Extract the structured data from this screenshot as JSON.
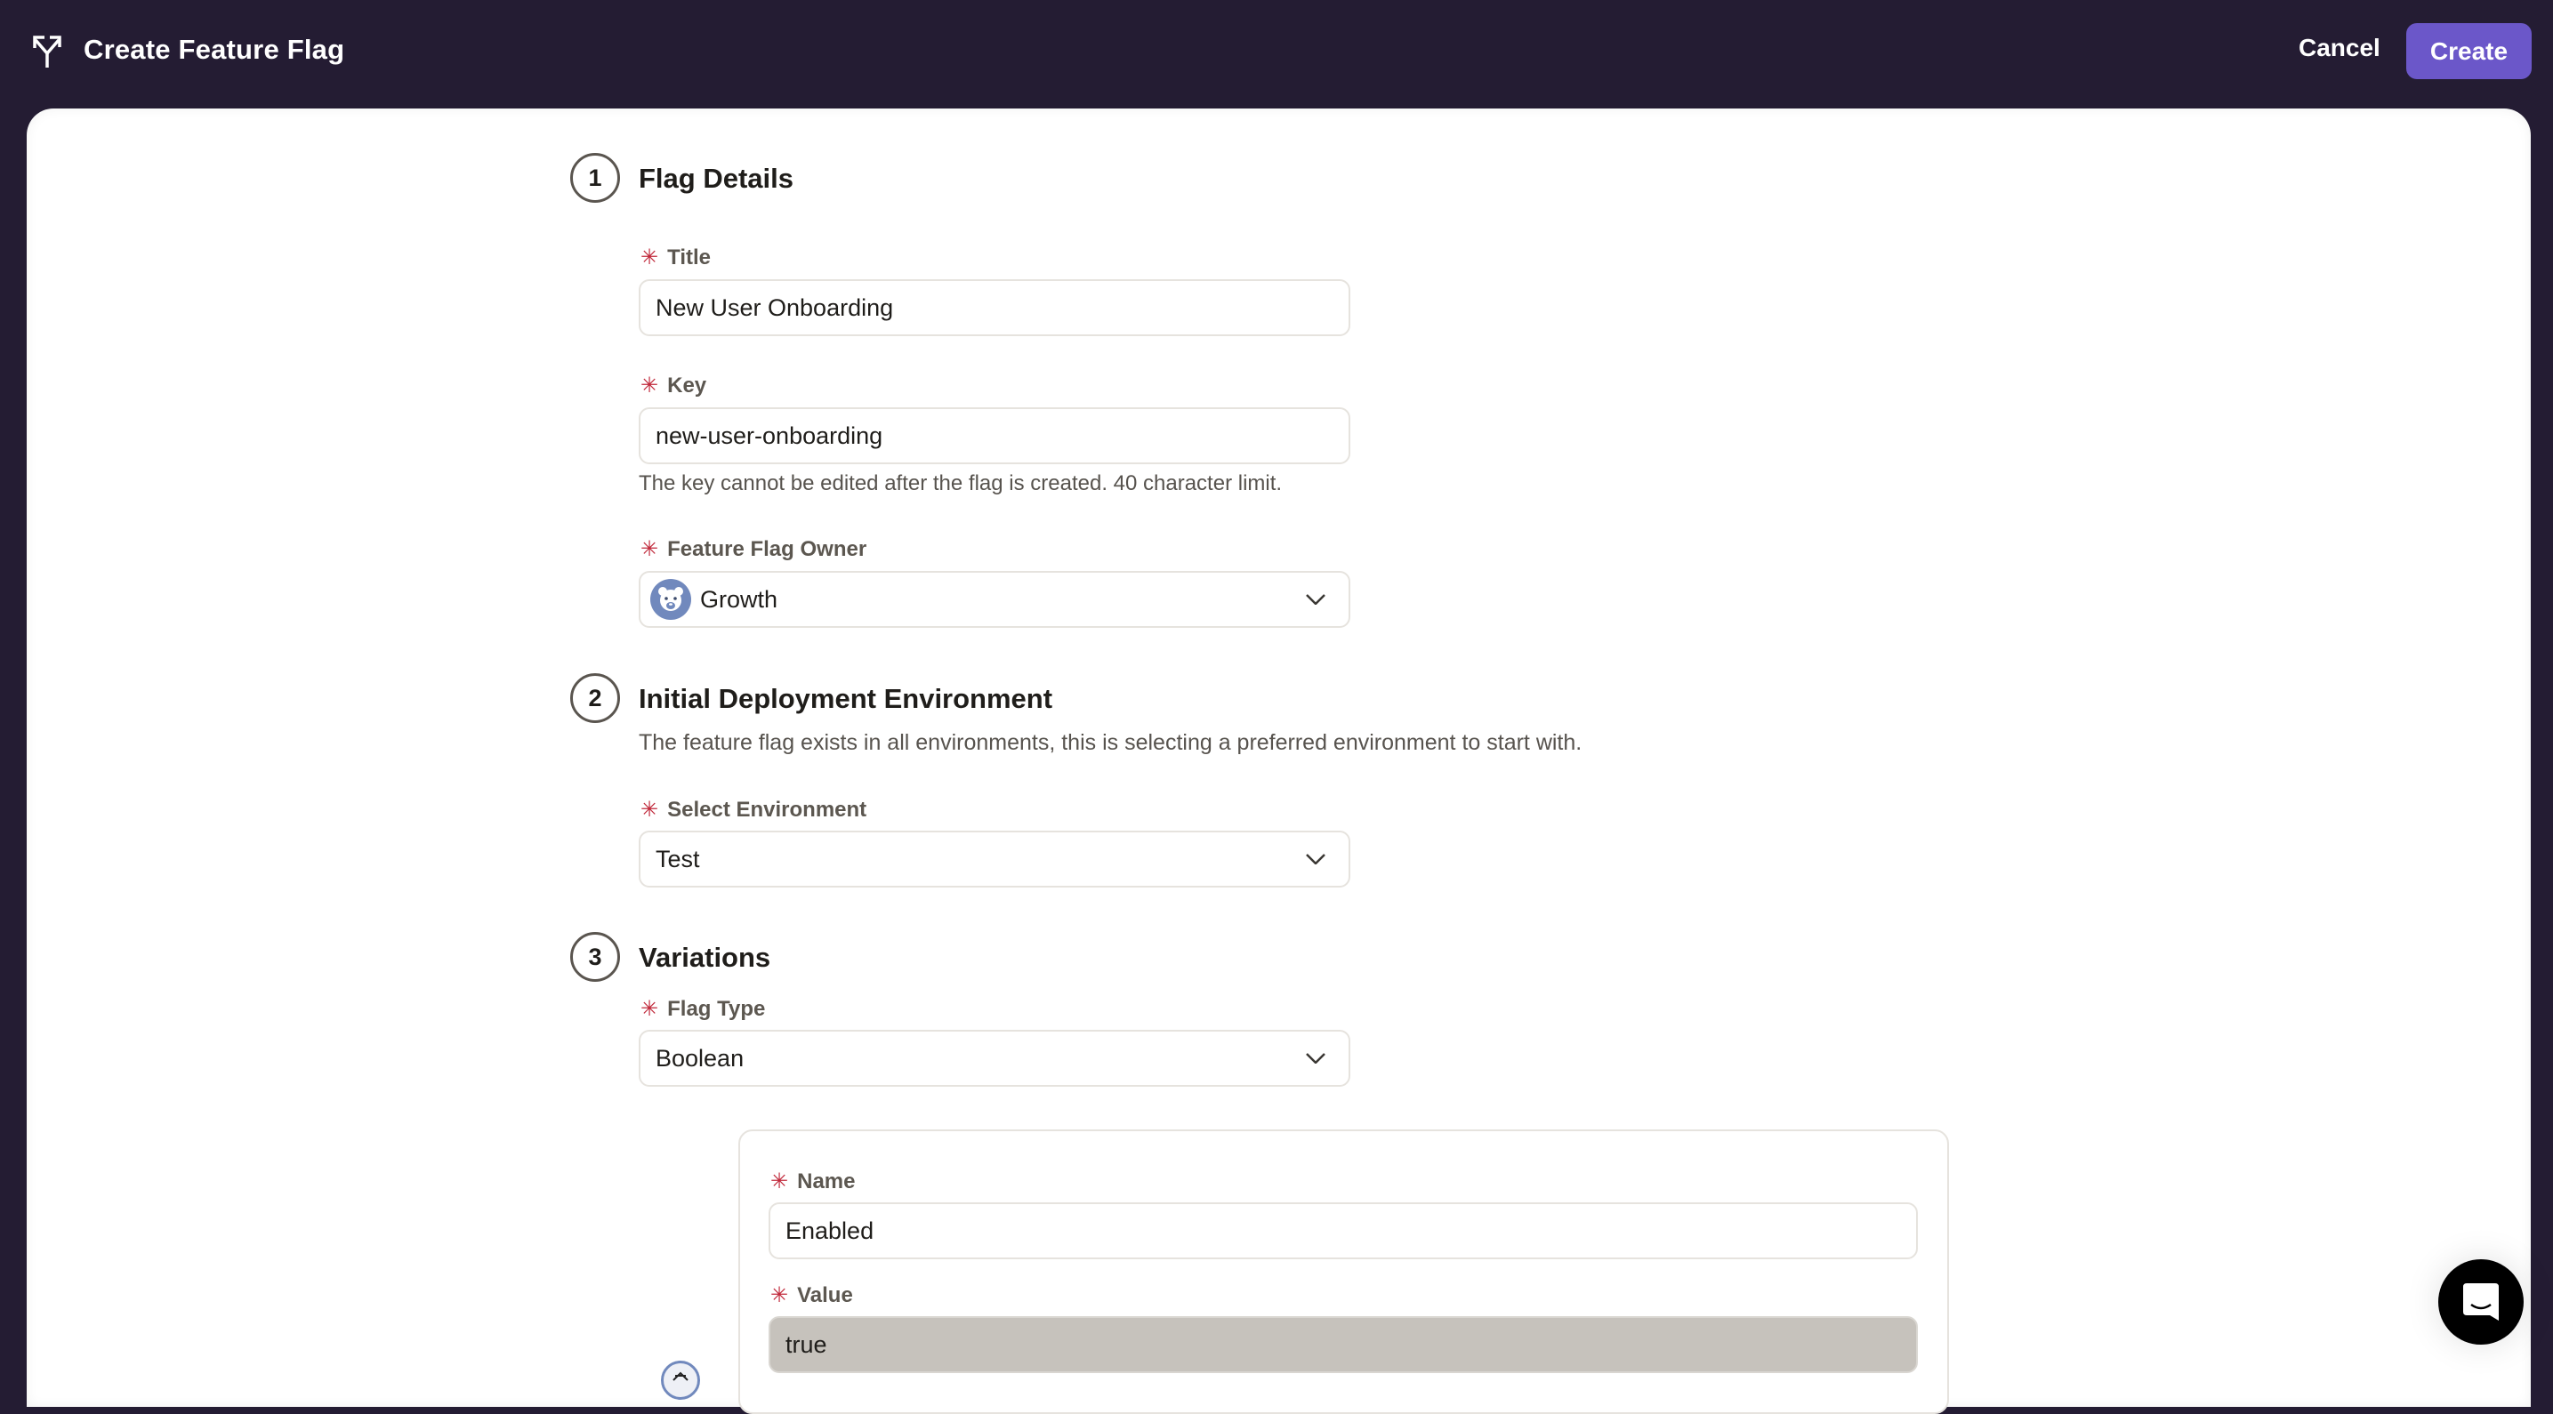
{
  "header": {
    "icon": "branch-icon",
    "title": "Create Feature Flag",
    "cancel_label": "Cancel",
    "create_label": "Create",
    "accent_color": "#6b57c9"
  },
  "sections": [
    {
      "number": "1",
      "title": "Flag Details",
      "fields": {
        "title": {
          "label": "Title",
          "required": true,
          "value": "New User Onboarding"
        },
        "key": {
          "label": "Key",
          "required": true,
          "value": "new-user-onboarding",
          "hint": "The key cannot be edited after the flag is created. 40 character limit."
        },
        "owner": {
          "label": "Feature Flag Owner",
          "required": true,
          "value": "Growth",
          "avatar": "bear-avatar-icon"
        }
      }
    },
    {
      "number": "2",
      "title": "Initial Deployment Environment",
      "description": "The feature flag exists in all environments, this is selecting a preferred environment to start with.",
      "fields": {
        "environment": {
          "label": "Select Environment",
          "required": true,
          "value": "Test"
        }
      }
    },
    {
      "number": "3",
      "title": "Variations",
      "fields": {
        "flag_type": {
          "label": "Flag Type",
          "required": true,
          "value": "Boolean"
        }
      },
      "variation": {
        "name": {
          "label": "Name",
          "required": true,
          "value": "Enabled"
        },
        "value": {
          "label": "Value",
          "required": true,
          "value": "true",
          "disabled": true
        }
      }
    }
  ],
  "required_marker": "✳",
  "chat_widget": {
    "icon": "chat-bubble-icon"
  }
}
